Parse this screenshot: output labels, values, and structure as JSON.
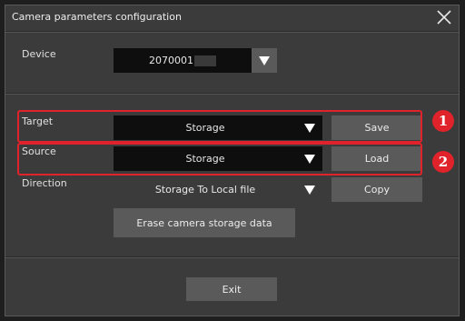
{
  "dialog": {
    "title": "Camera parameters configuration"
  },
  "device": {
    "label": "Device",
    "value": "2070001"
  },
  "target": {
    "label": "Target",
    "value": "Storage",
    "button": "Save"
  },
  "source": {
    "label": "Source",
    "value": "Storage",
    "button": "Load"
  },
  "direction": {
    "label": "Direction",
    "value": "Storage To Local file",
    "button": "Copy"
  },
  "erase_button": "Erase camera storage data",
  "exit_button": "Exit",
  "annotations": {
    "badge_1": "1",
    "badge_2": "2",
    "color": "#e0222b"
  },
  "icons": {
    "close": "close-icon",
    "dropdown": "triangle-down-icon"
  }
}
